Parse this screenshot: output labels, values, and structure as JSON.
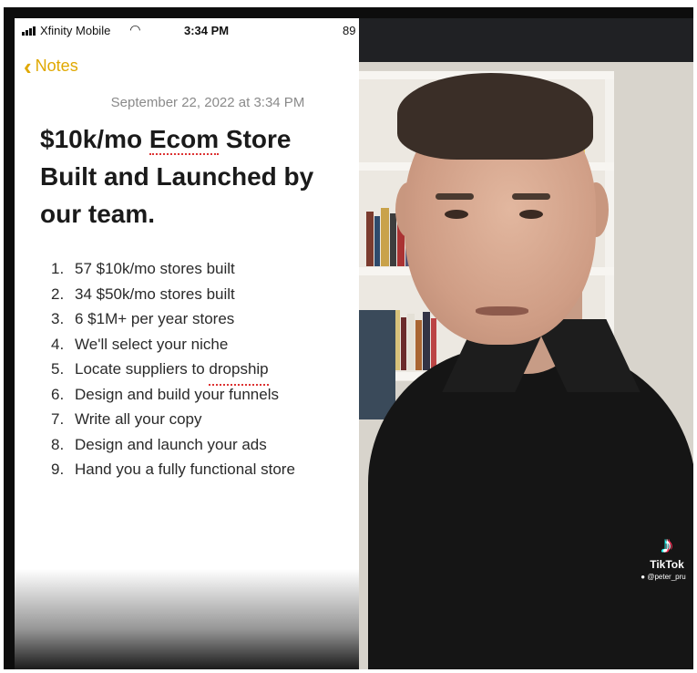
{
  "status_bar": {
    "carrier": "Xfinity Mobile",
    "time": "3:34 PM",
    "battery": "89"
  },
  "notes": {
    "back_label": "Notes",
    "date": "September 22, 2022 at 3:34 PM",
    "title_part1": "$10k/mo ",
    "title_part2": "Ecom",
    "title_part3": " Store Built and Launched by our team.",
    "items": [
      {
        "num": "1.",
        "pre": "57 $10k/mo stores built",
        "mark": "",
        "post": ""
      },
      {
        "num": "2.",
        "pre": "34 $50k/mo stores built",
        "mark": "",
        "post": ""
      },
      {
        "num": "3.",
        "pre": "6 $1M+ per year stores",
        "mark": "",
        "post": ""
      },
      {
        "num": "4.",
        "pre": "We'll select your niche",
        "mark": "",
        "post": ""
      },
      {
        "num": "5.",
        "pre": "Locate suppliers to ",
        "mark": "dropship",
        "post": ""
      },
      {
        "num": "6.",
        "pre": "Design and build your funnels",
        "mark": "",
        "post": ""
      },
      {
        "num": "7.",
        "pre": "Write all your copy",
        "mark": "",
        "post": ""
      },
      {
        "num": "8.",
        "pre": "Design and launch your ads",
        "mark": "",
        "post": ""
      },
      {
        "num": "9.",
        "pre": "Hand you a fully functional store",
        "mark": "",
        "post": ""
      }
    ]
  },
  "video": {
    "watermark": "TikTok",
    "handle": "@peter_pru"
  },
  "colors": {
    "accent": "#e0a800",
    "spellcheck": "#dd3333"
  }
}
